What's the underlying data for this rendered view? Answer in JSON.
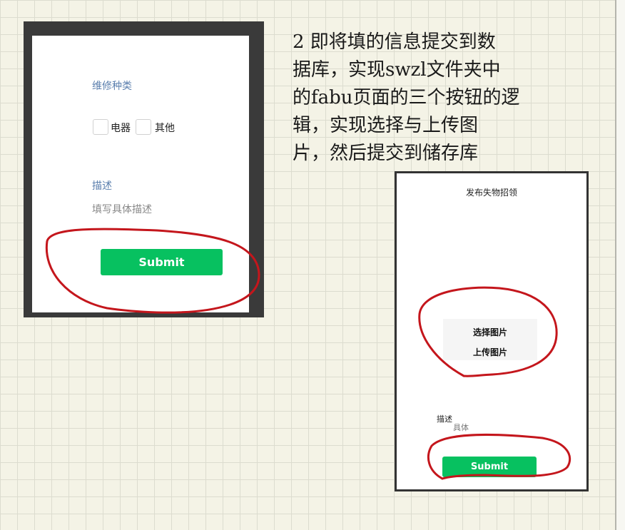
{
  "left_screen": {
    "repair_type_label": "维修种类",
    "options": [
      {
        "label": "电器",
        "checked": false
      },
      {
        "label": "其他",
        "checked": false
      }
    ],
    "description_label": "描述",
    "description_placeholder": "填写具体描述",
    "submit_label": "Submit"
  },
  "note": {
    "lines": [
      "2 即将填的信息提交到数",
      "据库，实现swzl文件夹中",
      "的fabu页面的三个按钮的逻",
      "辑，实现选择与上传图",
      "片，然后提交到储存库"
    ]
  },
  "right_screen": {
    "title": "发布失物招领",
    "choose_image_label": "选择图片",
    "upload_image_label": "上传图片",
    "description_label": "描述",
    "description_value": "具体",
    "submit_label": "Submit"
  },
  "colors": {
    "submit_green": "#07c160",
    "label_blue": "#5b7fae",
    "annotation_red": "#c4161c"
  }
}
